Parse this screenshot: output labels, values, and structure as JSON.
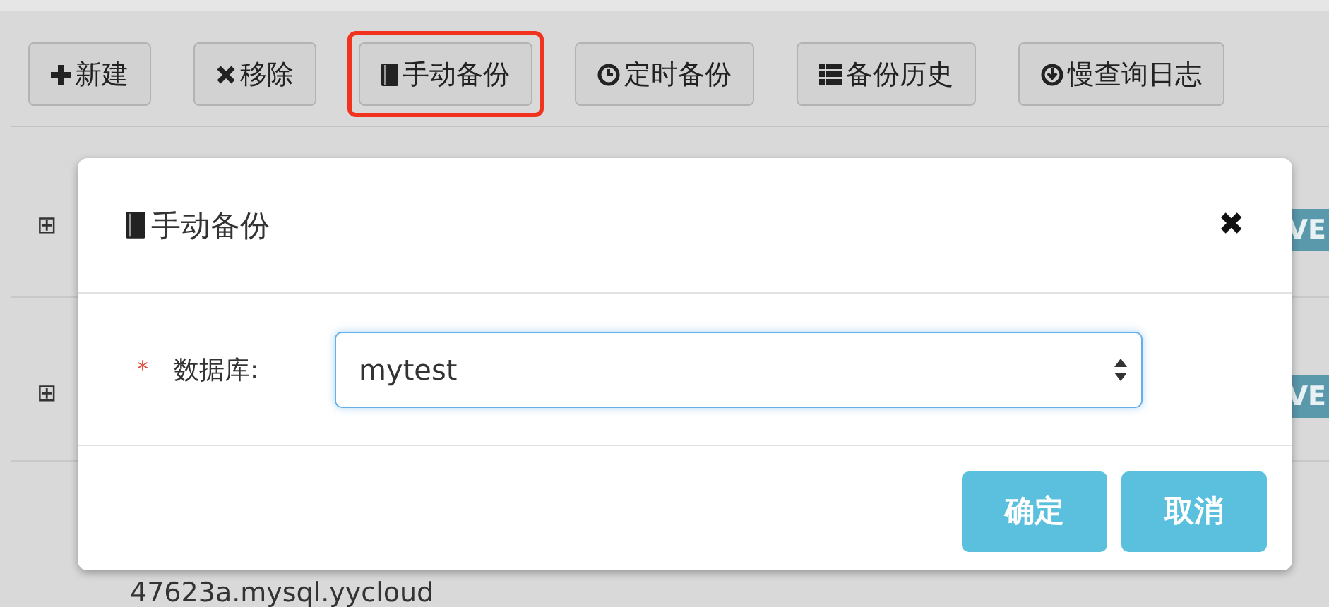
{
  "toolbar": [
    {
      "label": "新建",
      "highlighted": false
    },
    {
      "label": "移除",
      "highlighted": false
    },
    {
      "label": "手动备份",
      "highlighted": true
    },
    {
      "label": "定时备份",
      "highlighted": false
    },
    {
      "label": "备份历史",
      "highlighted": false
    },
    {
      "label": "慢查询日志",
      "highlighted": false
    }
  ],
  "rows": [
    {
      "expand": "⊞",
      "badge": "VE"
    },
    {
      "expand": "⊞",
      "badge": "VE"
    },
    {
      "name": "47623a.mysql.yycloud"
    }
  ],
  "dialog": {
    "title": "手动备份",
    "close": "✖",
    "required_mark": "*",
    "field_label": "数据库:",
    "field_value": "mytest",
    "buttons": [
      "确定",
      "取消"
    ]
  }
}
